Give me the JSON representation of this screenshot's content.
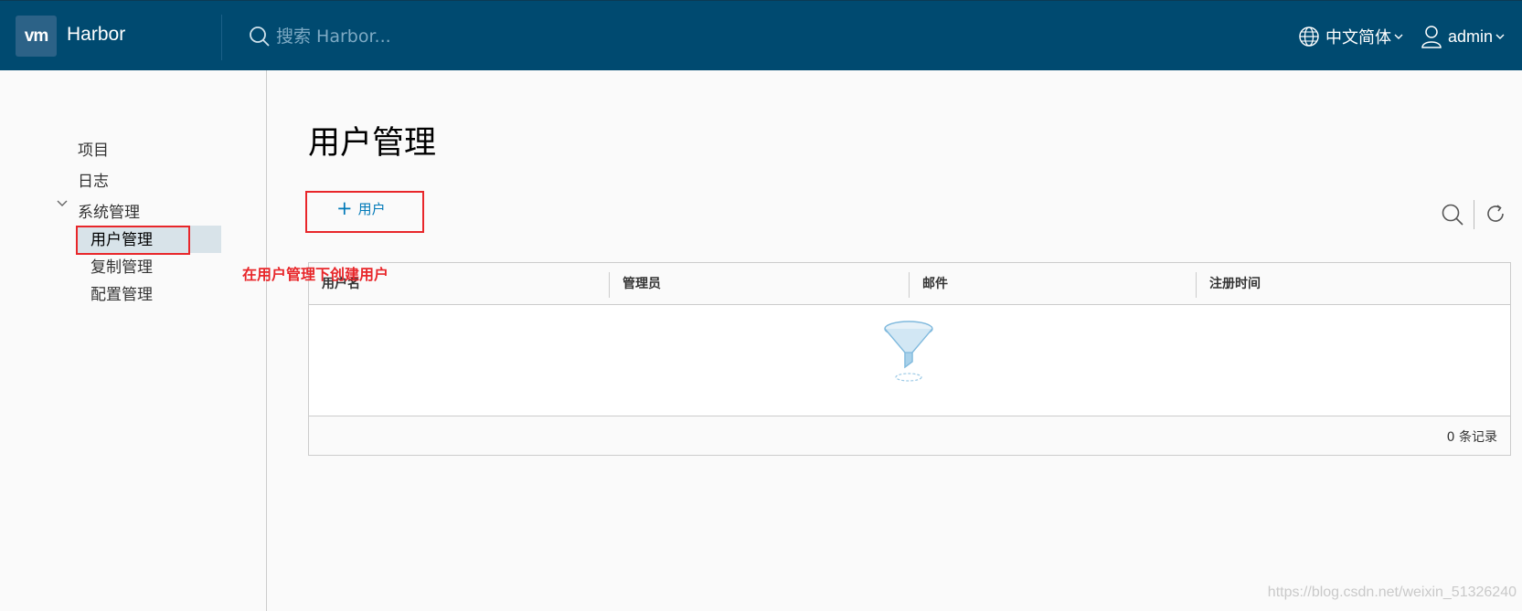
{
  "header": {
    "logo_text": "vm",
    "app_title": "Harbor",
    "search_placeholder": "搜索 Harbor...",
    "language": "中文简体",
    "username": "admin"
  },
  "sidebar": {
    "items": [
      {
        "label": "项目"
      },
      {
        "label": "日志"
      },
      {
        "label": "系统管理"
      }
    ],
    "sub_items": [
      {
        "label": "用户管理",
        "active": true
      },
      {
        "label": "复制管理"
      },
      {
        "label": "配置管理"
      }
    ]
  },
  "main": {
    "title": "用户管理",
    "add_user_label": "用户",
    "columns": [
      "用户名",
      "管理员",
      "邮件",
      "注册时间"
    ],
    "rows": [],
    "record_count": "0 条记录"
  },
  "annotation": {
    "note": "在用户管理下创建用户",
    "color": "#e8262a"
  },
  "watermark": "https://blog.csdn.net/weixin_51326240",
  "colors": {
    "header_bg": "#004a70",
    "accent": "#0079b8",
    "active_nav_bg": "#d8e3e9"
  }
}
